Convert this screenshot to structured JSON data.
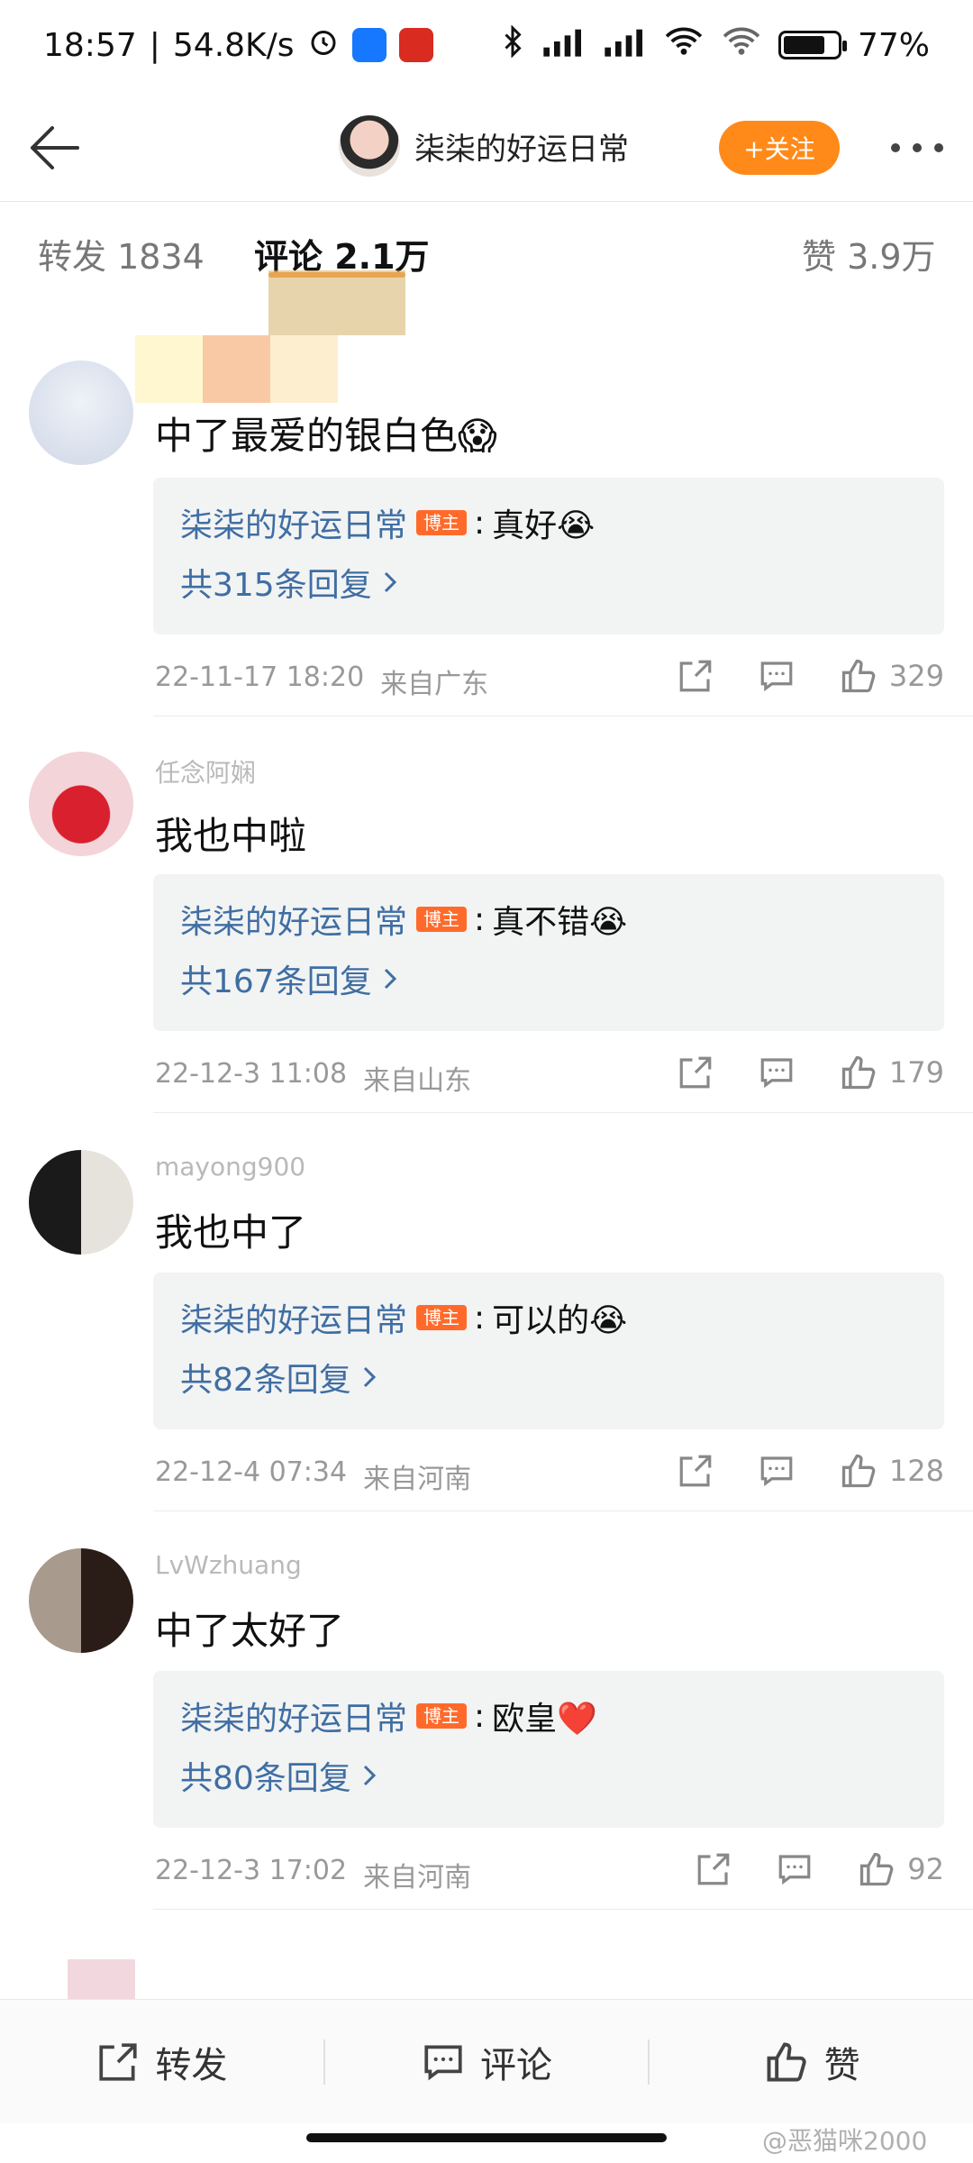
{
  "status_bar": {
    "time": "18:57",
    "net_speed": "54.8K/s",
    "battery": "77%",
    "battery_level": 0.77
  },
  "header": {
    "title": "柒柒的好运日常",
    "follow_label": "+关注"
  },
  "tabs": {
    "repost": "转发 1834",
    "comments": "评论 2.1万",
    "likes": "赞 3.9万"
  },
  "comments": [
    {
      "text": "中了最爱的银白色😱",
      "reply_author": "柒柒的好运日常",
      "blogger_tag": "博主",
      "reply_text": "真好😭",
      "reply_count": "共315条回复",
      "time": "22-11-17 18:20",
      "location": "来自广东",
      "likes": "329"
    },
    {
      "username": "任念阿娴",
      "text": "我也中啦",
      "reply_author": "柒柒的好运日常",
      "blogger_tag": "博主",
      "reply_text": "真不错😭",
      "reply_count": "共167条回复",
      "time": "22-12-3 11:08",
      "location": "来自山东",
      "likes": "179"
    },
    {
      "username": "mayong900",
      "text": "我也中了",
      "reply_author": "柒柒的好运日常",
      "blogger_tag": "博主",
      "reply_text": "可以的😭",
      "reply_count": "共82条回复",
      "time": "22-12-4 07:34",
      "location": "来自河南",
      "likes": "128"
    },
    {
      "username": "LvWzhuang",
      "text": "中了太好了",
      "reply_author": "柒柒的好运日常",
      "blogger_tag": "博主",
      "reply_text": "欧皇❤️",
      "reply_count": "共80条回复",
      "time": "22-12-3 17:02",
      "location": "来自河南",
      "likes": "92"
    }
  ],
  "bottom_bar": {
    "repost": "转发",
    "comment": "评论",
    "like": "赞"
  },
  "watermark": "@恶猫咪2000",
  "colors": {
    "accent": "#ff8a1a",
    "link": "#3f6ea3",
    "blogger_tag": "#ff6a2b"
  }
}
